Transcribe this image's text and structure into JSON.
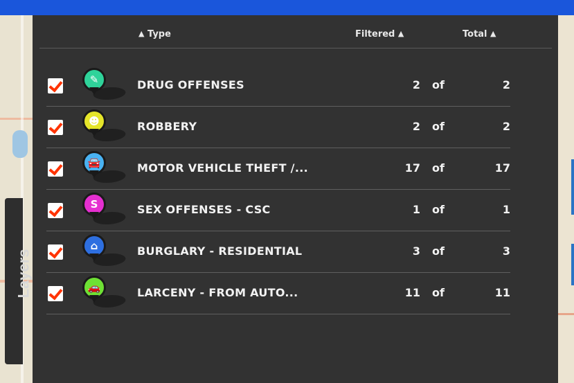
{
  "header": {
    "type_label": "Type",
    "filtered_label": "Filtered",
    "total_label": "Total",
    "sort_caret": "▲"
  },
  "side_tab": {
    "label": "Layers"
  },
  "rows": [
    {
      "label": "DRUG OFFENSES",
      "filtered": "2",
      "of": "of",
      "total": "2",
      "icon": "drug-pin-icon",
      "color": "#2fd39a",
      "glyph": "✎",
      "checked": true
    },
    {
      "label": "ROBBERY",
      "filtered": "2",
      "of": "of",
      "total": "2",
      "icon": "robbery-pin-icon",
      "color": "#e5e52a",
      "glyph": "☻",
      "checked": true
    },
    {
      "label": "MOTOR VEHICLE THEFT /...",
      "filtered": "17",
      "of": "of",
      "total": "17",
      "icon": "vehicle-pin-icon",
      "color": "#49b2f2",
      "glyph": "🚘",
      "checked": true
    },
    {
      "label": "SEX OFFENSES - CSC",
      "filtered": "1",
      "of": "of",
      "total": "1",
      "icon": "sex-offense-pin-icon",
      "color": "#e52fd0",
      "glyph": "S",
      "checked": true
    },
    {
      "label": "BURGLARY - RESIDENTIAL",
      "filtered": "3",
      "of": "of",
      "total": "3",
      "icon": "house-pin-icon",
      "color": "#2e6fe0",
      "glyph": "⌂",
      "checked": true
    },
    {
      "label": "LARCENY - FROM AUTO...",
      "filtered": "11",
      "of": "of",
      "total": "11",
      "icon": "car-pin-icon",
      "color": "#6ee034",
      "glyph": "🚗",
      "checked": true
    }
  ]
}
